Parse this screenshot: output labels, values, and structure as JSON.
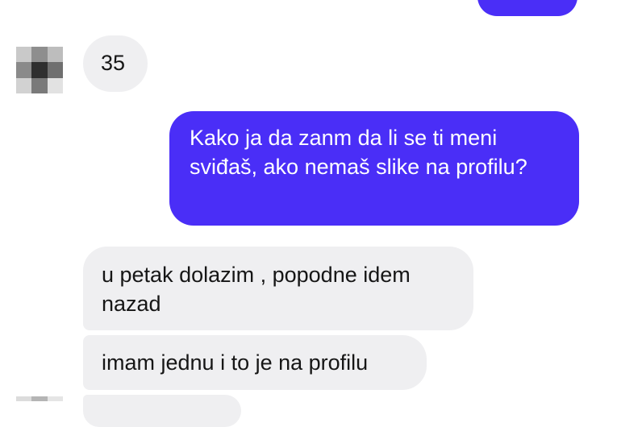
{
  "messages": [
    {
      "id": "m0",
      "direction": "outgoing",
      "text": ""
    },
    {
      "id": "m1",
      "direction": "incoming",
      "text": "35"
    },
    {
      "id": "m2",
      "direction": "outgoing",
      "text": "Kako ja da zanm da li se ti meni sviđaš, ako nemaš slike na profilu?"
    },
    {
      "id": "m3",
      "direction": "incoming",
      "text": "u petak dolazim , popodne idem nazad"
    },
    {
      "id": "m4",
      "direction": "incoming",
      "text": "imam jednu i to je na profilu"
    },
    {
      "id": "m5",
      "direction": "incoming",
      "text": ""
    }
  ],
  "contact": {
    "avatar_icon": "pixelated-avatar-icon"
  },
  "colors": {
    "outgoing_bubble": "#4a2ef7",
    "incoming_bubble": "#efeff1",
    "incoming_text": "#161616",
    "outgoing_text": "#ffffff"
  }
}
